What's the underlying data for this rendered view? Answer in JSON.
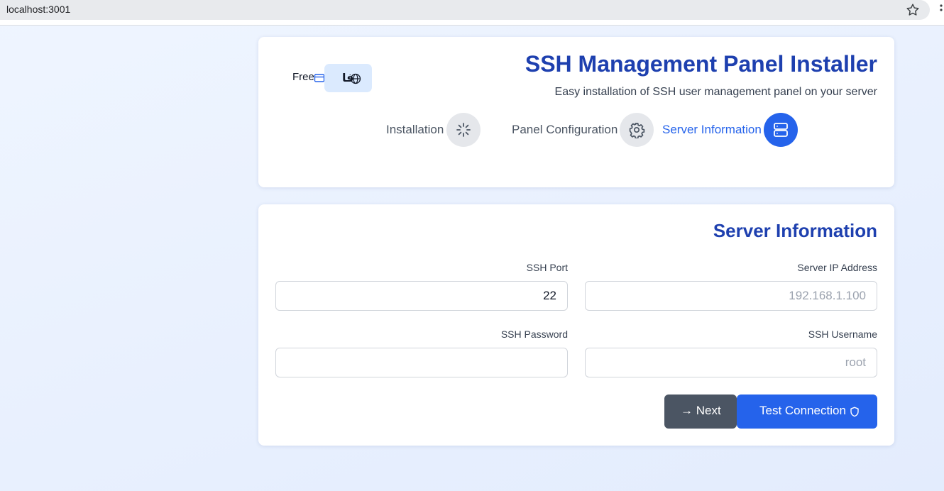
{
  "browser": {
    "address": "localhost:3001",
    "icons": [
      "star-icon",
      "more-icon"
    ]
  },
  "header": {
    "title": "SSH Management Panel Installer",
    "subtitle": "Easy installation of SSH user management panel on your server",
    "free_label": "Free",
    "language_label": "فا",
    "icons": [
      "card-icon",
      "globe-icon"
    ]
  },
  "steps": [
    {
      "label": "Installation",
      "icon": "spinner-icon",
      "state": "pending"
    },
    {
      "label": "Panel Configuration",
      "icon": "gear-icon",
      "state": "pending"
    },
    {
      "label": "Server Information",
      "icon": "server-icon",
      "state": "active"
    }
  ],
  "form": {
    "title": "Server Information",
    "fields": {
      "ssh_port": {
        "label": "SSH Port",
        "value": "22",
        "placeholder": ""
      },
      "server_ip": {
        "label": "Server IP Address",
        "value": "",
        "placeholder": "192.168.1.100"
      },
      "ssh_password": {
        "label": "SSH Password",
        "value": "",
        "placeholder": ""
      },
      "ssh_username": {
        "label": "SSH Username",
        "value": "",
        "placeholder": "root"
      }
    },
    "buttons": {
      "next": "→ Next",
      "test_connection": "Test Connection"
    }
  },
  "colors": {
    "accent": "#2563eb",
    "title": "#1e40af",
    "secondary_button": "#4b5563",
    "lang_button_bg": "#dbeafe",
    "step_inactive_bg": "#e5e7eb"
  }
}
